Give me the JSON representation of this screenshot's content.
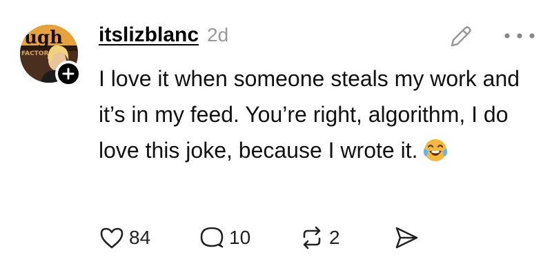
{
  "post": {
    "username": "itslizblanc",
    "time": "2d",
    "text": "I love it when someone steals my work and it’s in my feed. You’re right, algorithm, I do love this joke, because I wrote it.",
    "emoji": "face-with-tears-of-joy",
    "avatar_sign_text": "ugh",
    "avatar_sign_subtext": "FACTOR"
  },
  "actions": {
    "likes": "84",
    "replies": "10",
    "reposts": "2"
  },
  "icons": {
    "follow": "plus-icon",
    "edit": "pencil-icon",
    "more": "more-dots-icon",
    "like": "heart-icon",
    "reply": "speech-bubble-icon",
    "repost": "repost-icon",
    "share": "send-icon"
  },
  "colors": {
    "text": "#111111",
    "muted": "#999999",
    "emoji": "#f5b83d"
  }
}
